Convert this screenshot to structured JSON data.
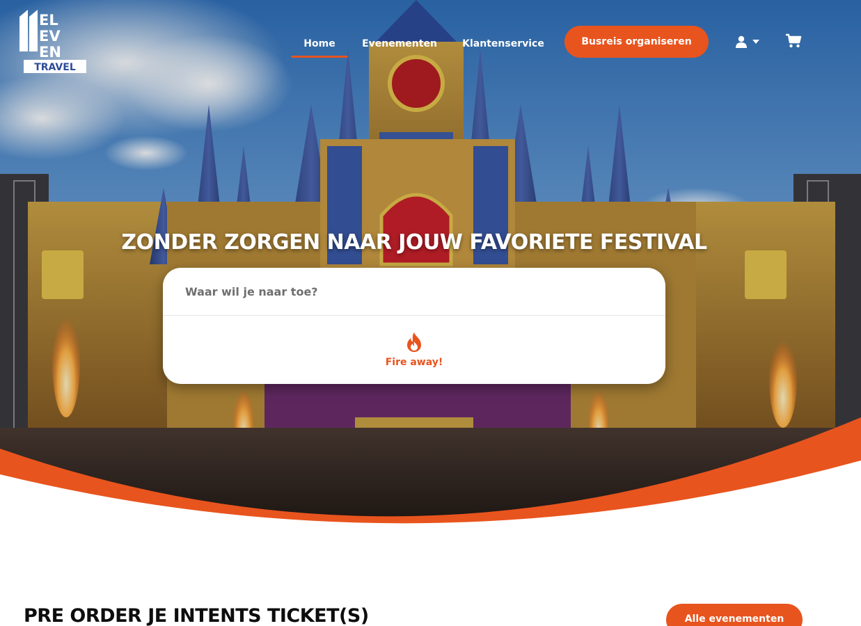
{
  "brand": {
    "logo_number": "11",
    "logo_words": [
      "EL",
      "EV",
      "EN"
    ],
    "logo_sub": "TRAVEL",
    "accent_color": "#e8541e"
  },
  "nav": {
    "items": [
      {
        "label": "Home",
        "active": true
      },
      {
        "label": "Evenementen",
        "active": false
      },
      {
        "label": "Klantenservice",
        "active": false
      }
    ],
    "cta_label": "Busreis organiseren",
    "user_icon": "user-icon",
    "cart_icon": "cart-icon"
  },
  "hero": {
    "title": "ZONDER ZORGEN NAAR JOUW FAVORIETE FESTIVAL",
    "search_placeholder": "Waar wil je naar toe?",
    "search_value": "",
    "submit_label": "Fire away!",
    "submit_icon": "fire-icon"
  },
  "section": {
    "title": "PRE ORDER JE INTENTS TICKET(S)",
    "button_label": "Alle evenementen"
  }
}
